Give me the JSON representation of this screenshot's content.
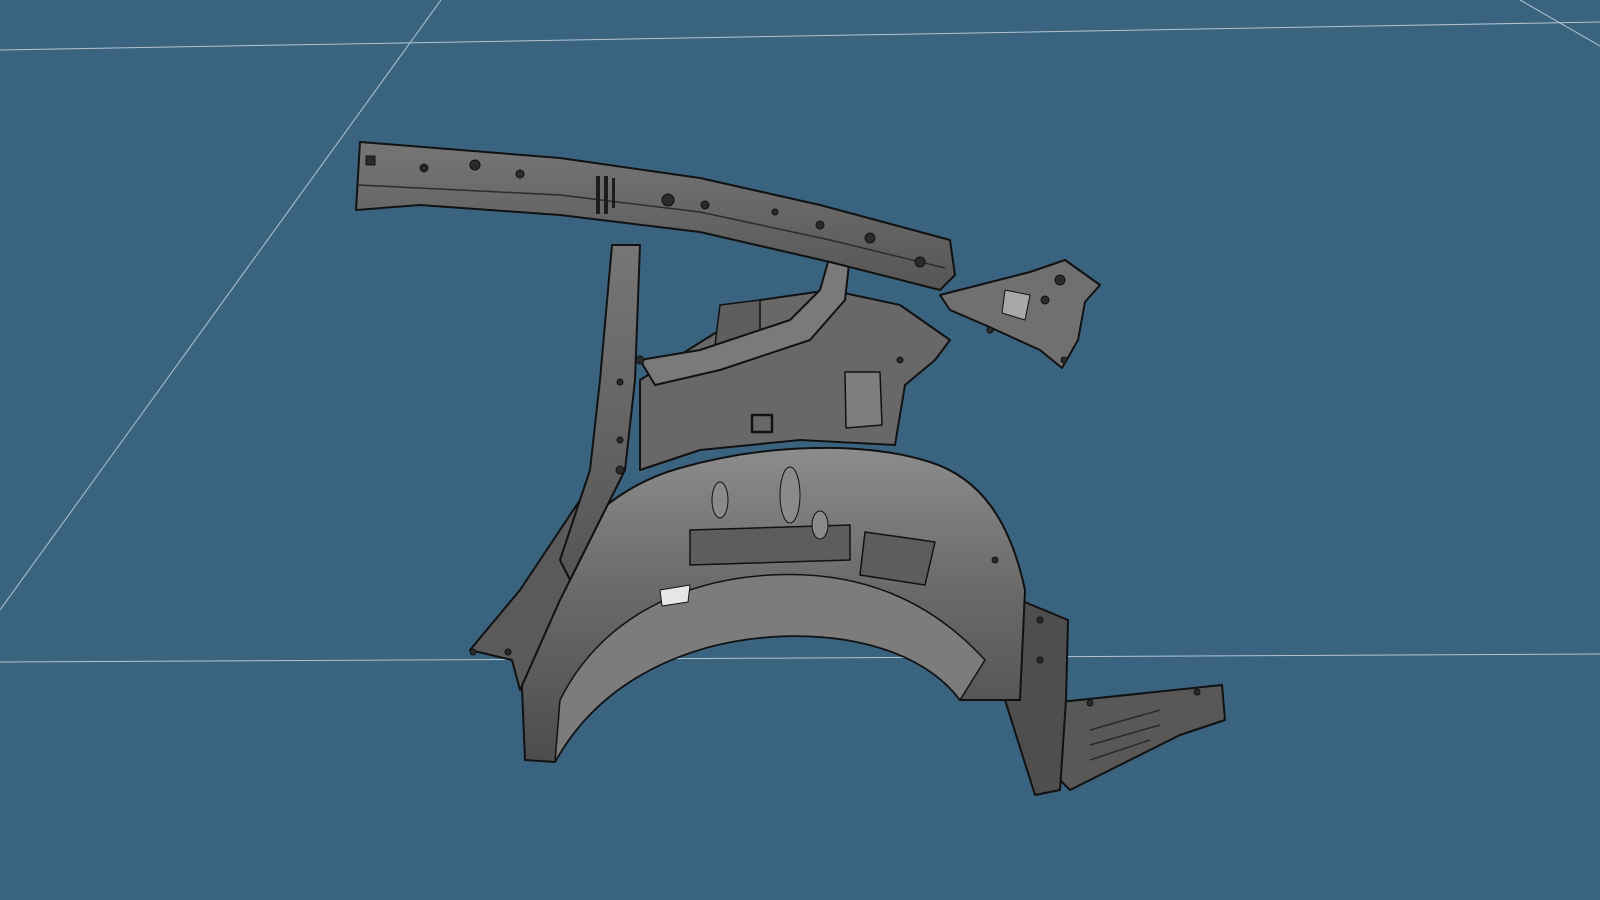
{
  "viewport": {
    "background_color": "#3a637f",
    "grid_color": "#c9d6df",
    "part_fill_color": "#636363",
    "part_highlight_color": "#8a8a8a",
    "part_edge_color": "#111111"
  },
  "model": {
    "type": "car body side panel / rear wheel arch (3D CAD)",
    "shading": "gray metallic",
    "icon": "3d-part-icon"
  }
}
